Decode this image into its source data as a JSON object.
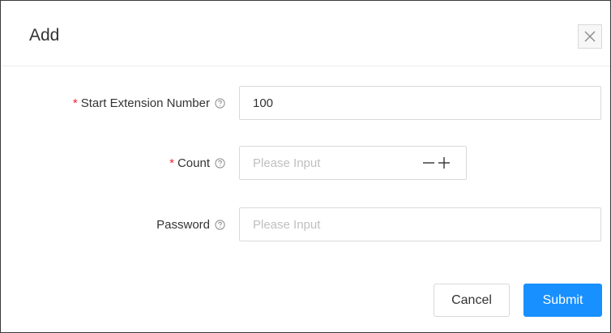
{
  "dialog": {
    "title": "Add",
    "close_icon": "close-icon"
  },
  "form": {
    "start_extension": {
      "required_mark": "*",
      "label": "Start Extension Number",
      "help_icon": "question-circle-icon",
      "value": "100"
    },
    "count": {
      "required_mark": "*",
      "label": "Count",
      "help_icon": "question-circle-icon",
      "placeholder": "Please Input",
      "value": "",
      "decrement_icon": "minus-icon",
      "increment_icon": "plus-icon"
    },
    "password": {
      "label": "Password",
      "help_icon": "question-circle-icon",
      "placeholder": "Please Input",
      "value": ""
    }
  },
  "footer": {
    "cancel_label": "Cancel",
    "submit_label": "Submit"
  },
  "colors": {
    "primary": "#1890ff",
    "required": "#f5222d",
    "border": "#d9d9d9",
    "placeholder": "#bfbfbf"
  }
}
